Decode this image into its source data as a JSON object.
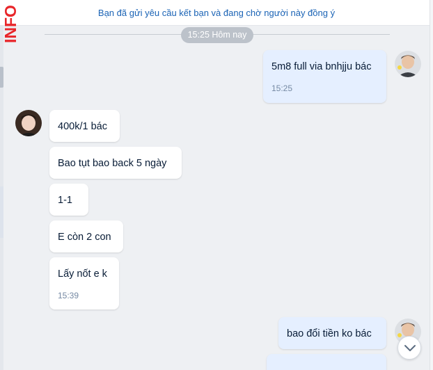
{
  "brand": {
    "text": "INFO"
  },
  "notice": {
    "text": "Bạn đã gửi yêu cầu kết bạn và đang chờ người này đồng ý"
  },
  "separator": {
    "time_label": "15:25 Hôm nay"
  },
  "messages": [
    {
      "from": "me",
      "text": "5m8 full via bnhjju bác",
      "time": "15:25"
    },
    {
      "from": "them",
      "text": "400k/1 bác",
      "time": ""
    },
    {
      "from": "them",
      "text": "Bao tụt bao back 5 ngày",
      "time": ""
    },
    {
      "from": "them",
      "text": "1-1",
      "time": ""
    },
    {
      "from": "them",
      "text": "E còn 2 con",
      "time": ""
    },
    {
      "from": "them",
      "text": "Lấy nốt e k",
      "time": "15:39"
    },
    {
      "from": "me",
      "text": "bao đổi tiền ko bác",
      "time": ""
    },
    {
      "from": "me",
      "text": "",
      "time": ""
    }
  ],
  "icons": {
    "scroll_down": "chevron-down-icon",
    "avatar_me": "user-avatar",
    "avatar_them": "contact-avatar"
  },
  "colors": {
    "my_bubble": "#e5efff",
    "their_bubble": "#ffffff",
    "notice_text": "#1a63b5",
    "brand_red": "#e8262a"
  }
}
